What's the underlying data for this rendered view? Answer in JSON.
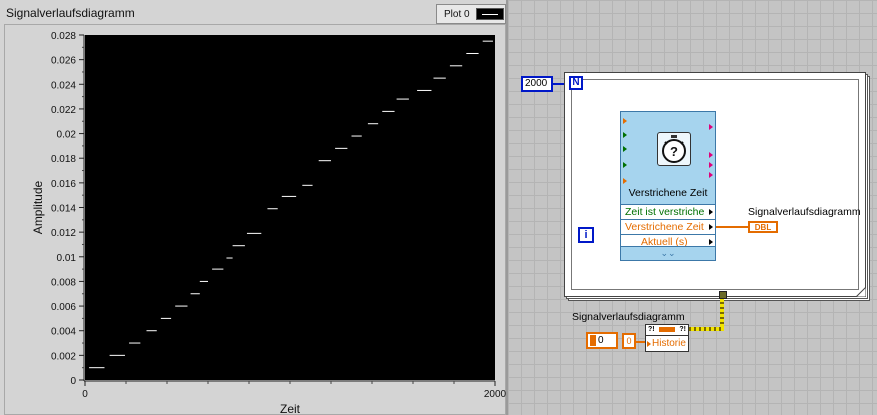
{
  "front_panel": {
    "graph_title": "Signalverlaufsdiagramm",
    "legend": {
      "plot_name": "Plot 0"
    }
  },
  "chart_data": {
    "type": "line",
    "title": "Signalverlaufsdiagramm",
    "xlabel": "Zeit",
    "ylabel": "Amplitude",
    "xlim": [
      0,
      2000
    ],
    "ylim": [
      0,
      0.028
    ],
    "x_ticks": [
      "0",
      "2000"
    ],
    "y_ticks": [
      "0",
      "0.002",
      "0.004",
      "0.006",
      "0.008",
      "0.01",
      "0.012",
      "0.014",
      "0.016",
      "0.018",
      "0.02",
      "0.022",
      "0.024",
      "0.026",
      "0.028"
    ],
    "grid": false,
    "background": "#000000",
    "plot_color": "#ffffff",
    "series": [
      {
        "name": "Plot 0",
        "segments": [
          [
            20,
            95,
            0.001
          ],
          [
            120,
            195,
            0.002
          ],
          [
            215,
            270,
            0.003
          ],
          [
            300,
            350,
            0.004
          ],
          [
            370,
            420,
            0.005
          ],
          [
            440,
            500,
            0.006
          ],
          [
            515,
            560,
            0.007
          ],
          [
            560,
            600,
            0.008
          ],
          [
            620,
            675,
            0.009
          ],
          [
            690,
            720,
            0.0099
          ],
          [
            720,
            780,
            0.0109
          ],
          [
            790,
            860,
            0.0119
          ],
          [
            890,
            940,
            0.0139
          ],
          [
            960,
            1030,
            0.0149
          ],
          [
            1060,
            1110,
            0.0158
          ],
          [
            1140,
            1200,
            0.0178
          ],
          [
            1220,
            1280,
            0.0188
          ],
          [
            1300,
            1350,
            0.0198
          ],
          [
            1380,
            1430,
            0.0208
          ],
          [
            1450,
            1510,
            0.0218
          ],
          [
            1520,
            1580,
            0.0228
          ],
          [
            1620,
            1690,
            0.0235
          ],
          [
            1700,
            1760,
            0.0245
          ],
          [
            1780,
            1840,
            0.0255
          ],
          [
            1860,
            1920,
            0.0265
          ],
          [
            1940,
            1990,
            0.0275
          ]
        ]
      }
    ]
  },
  "block_diagram": {
    "loop_count": "2000",
    "n_terminal": "N",
    "i_terminal": "i",
    "express_vi": {
      "name": "Verstrichene Zeit",
      "rows": [
        "Zeit ist verstriche",
        "Verstrichene Zeit",
        "Aktuell (s)"
      ],
      "more": "⌄⌄",
      "row_colors": [
        "#007000",
        "#e46c00",
        "#e46c00"
      ]
    },
    "indicator": {
      "label": "Signalverlaufsdiagramm",
      "type": "DBL"
    },
    "property_node": {
      "label": "Signalverlaufsdiagramm",
      "property": "Historie",
      "constant": "0",
      "constant_ind": "0"
    },
    "colors": {
      "int_wire": "#0018c8",
      "dbl_wire": "#e46c00",
      "waveform_wire": "#f2e400"
    }
  }
}
